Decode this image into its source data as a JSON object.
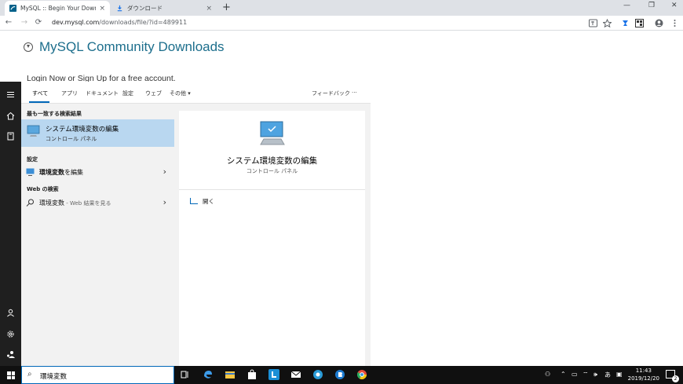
{
  "browser": {
    "tabs": [
      {
        "title": "MySQL :: Begin Your Download",
        "close": "×"
      },
      {
        "title": "ダウンロード",
        "close": "×"
      }
    ],
    "new_tab": "+",
    "window_controls": [
      "—",
      "❐",
      "✕"
    ],
    "nav": {
      "back": "←",
      "forward": "→",
      "reload": "⟳"
    },
    "url_host": "dev.mysql.com",
    "url_path": "/downloads/file/?id=489911"
  },
  "page": {
    "title": "MySQL Community Downloads",
    "login_text": "Login Now or Sign Up for a free account."
  },
  "start_menu": {
    "filters": [
      "すべて",
      "アプリ",
      "ドキュメント",
      "設定",
      "ウェブ",
      "その他 ▾"
    ],
    "feedback": "フィードバック",
    "more": "···",
    "best_match_header": "最も一致する検索結果",
    "best_match": {
      "name": "システム環境変数の編集",
      "subtitle": "コントロール パネル"
    },
    "settings_header": "設定",
    "settings_item": {
      "bold": "環境変数",
      "rest": "を編集"
    },
    "web_header": "Web の検索",
    "web_item": {
      "term": "環境変数",
      "hint": " - Web 結果を見る"
    },
    "detail": {
      "title": "システム環境変数の編集",
      "subtitle": "コントロール パネル",
      "open": "開く"
    },
    "chevron": "›"
  },
  "taskbar": {
    "search_value": "環境変数",
    "ime": "あ",
    "time": "11:43",
    "date": "2019/12/20",
    "notifications": "2"
  },
  "colors": {
    "accent": "#0067b8",
    "selection": "#b9d7f0",
    "mysql_blue": "#1c6e8c"
  }
}
